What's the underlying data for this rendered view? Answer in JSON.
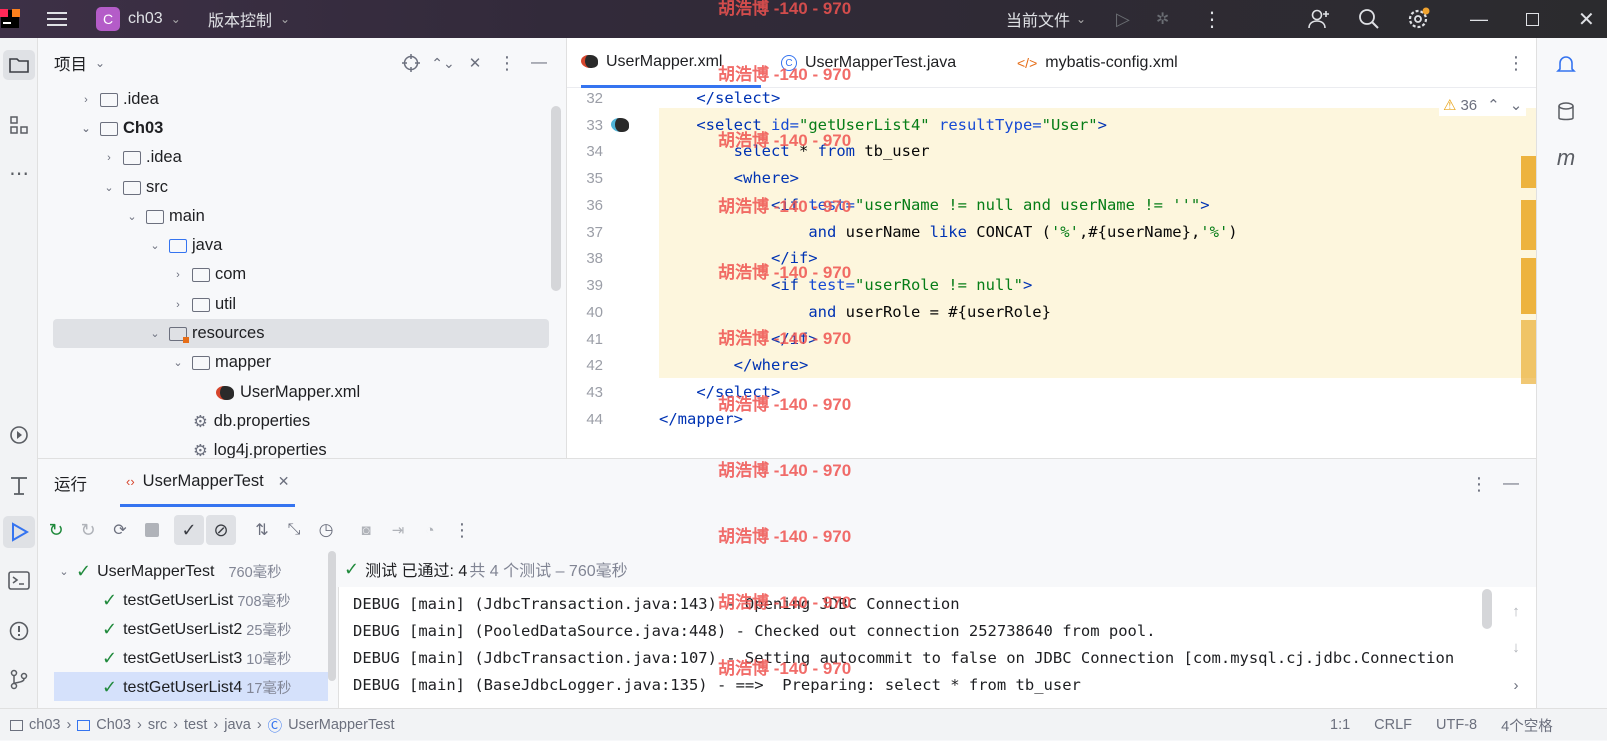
{
  "app": {
    "project_badge": "C",
    "project_name": "ch03",
    "vcs_menu": "版本控制",
    "run_config": "当前文件"
  },
  "project_panel": {
    "title": "项目",
    "tree": [
      {
        "label": ".idea",
        "chevron": "›",
        "kind": "folder"
      },
      {
        "label": "Ch03",
        "chevron": "⌄",
        "kind": "folder",
        "bold": true
      },
      {
        "label": ".idea",
        "chevron": "›",
        "kind": "folder"
      },
      {
        "label": "src",
        "chevron": "⌄",
        "kind": "folder"
      },
      {
        "label": "main",
        "chevron": "⌄",
        "kind": "folder"
      },
      {
        "label": "java",
        "chevron": "⌄",
        "kind": "folder-blue"
      },
      {
        "label": "com",
        "chevron": "›",
        "kind": "package"
      },
      {
        "label": "util",
        "chevron": "›",
        "kind": "package"
      },
      {
        "label": "resources",
        "chevron": "⌄",
        "kind": "folder-resources",
        "selected": true
      },
      {
        "label": "mapper",
        "chevron": "⌄",
        "kind": "folder"
      },
      {
        "label": "UserMapper.xml",
        "chevron": "",
        "kind": "mybatis-file"
      },
      {
        "label": "db.properties",
        "chevron": "",
        "kind": "properties-file"
      },
      {
        "label": "log4j.properties",
        "chevron": "",
        "kind": "properties-file"
      }
    ]
  },
  "editor": {
    "tabs": [
      {
        "label": "UserMapper.xml",
        "active": true
      },
      {
        "label": "UserMapperTest.java",
        "active": false
      },
      {
        "label": "mybatis-config.xml",
        "active": false
      }
    ],
    "warnings_count": "36",
    "line_numbers": [
      "32",
      "33",
      "34",
      "35",
      "36",
      "37",
      "38",
      "39",
      "40",
      "41",
      "42",
      "43",
      "44"
    ]
  },
  "run_panel": {
    "title": "运行",
    "tab_label": "UserMapperTest",
    "summary_status": "测试 已通过: 4",
    "summary_detail": "共 4 个测试 – 760毫秒",
    "tests": [
      {
        "name": "UserMapperTest",
        "time": "760毫秒",
        "root": true
      },
      {
        "name": "testGetUserList",
        "time": "708毫秒"
      },
      {
        "name": "testGetUserList2",
        "time": "25毫秒"
      },
      {
        "name": "testGetUserList3",
        "time": "10毫秒"
      },
      {
        "name": "testGetUserList4",
        "time": "17毫秒",
        "selected": true
      }
    ],
    "console": [
      "DEBUG [main] (JdbcTransaction.java:143) - Opening JDBC Connection",
      "DEBUG [main] (PooledDataSource.java:448) - Checked out connection 252738640 from pool.",
      "DEBUG [main] (JdbcTransaction.java:107) - Setting autocommit to false on JDBC Connection [com.mysql.cj.jdbc.Connection",
      "DEBUG [main] (BaseJdbcLogger.java:135) - ==>  Preparing: select * from tb_user"
    ]
  },
  "statusbar": {
    "breadcrumb": [
      "ch03",
      "Ch03",
      "src",
      "test",
      "java",
      "UserMapperTest"
    ],
    "position": "1:1",
    "line_sep": "CRLF",
    "encoding": "UTF-8",
    "indent": "4个空格"
  },
  "watermark": "胡浩博 -140 - 970",
  "colors": {
    "accent": "#3574f0",
    "pass": "#208a3c",
    "highlight": "#fdf6dd",
    "warning": "#e8a317"
  }
}
